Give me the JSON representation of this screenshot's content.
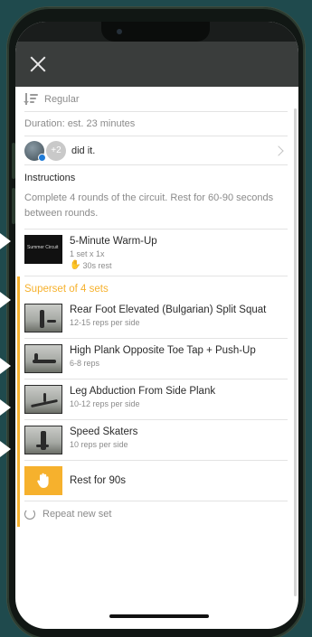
{
  "header": {
    "close_icon": "close-icon"
  },
  "meta": {
    "sort_label": "Regular",
    "duration": "Duration: est. 23 minutes",
    "did_it": {
      "extra_count": "+2",
      "text": "did it."
    }
  },
  "instructions": {
    "heading": "Instructions",
    "body": "Complete 4 rounds of the circuit. Rest for 60-90 seconds between rounds."
  },
  "warmup": {
    "title": "5-Minute Warm-Up",
    "sets": "1 set x 1x",
    "rest": "30s rest",
    "thumb_label": "Summer Circuit"
  },
  "superset": {
    "title": "Superset of 4 sets",
    "exercises": [
      {
        "title": "Rear Foot Elevated (Bulgarian) Split Squat",
        "reps": "12-15 reps per side"
      },
      {
        "title": "High Plank Opposite Toe Tap + Push-Up",
        "reps": "6-8 reps"
      },
      {
        "title": "Leg Abduction From Side Plank",
        "reps": "10-12 reps per side"
      },
      {
        "title": "Speed Skaters",
        "reps": "10 reps per side"
      }
    ],
    "rest_label": "Rest for 90s",
    "repeat_label": "Repeat new set"
  },
  "colors": {
    "accent": "#f6b12d",
    "background": "#1f4a4d",
    "topbar": "#3a3d3c"
  }
}
